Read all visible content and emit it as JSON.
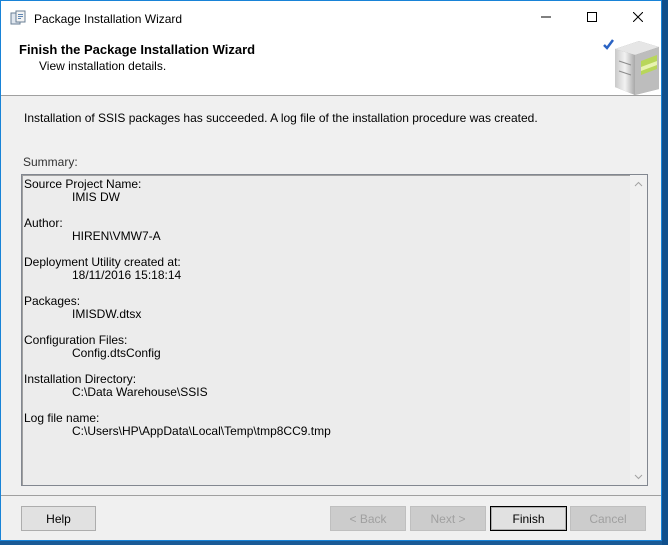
{
  "window": {
    "title": "Package Installation Wizard"
  },
  "header": {
    "title": "Finish the Package Installation Wizard",
    "subtitle": "View installation details."
  },
  "status": {
    "message": "Installation of SSIS packages has succeeded. A log file of the installation procedure was created."
  },
  "summary": {
    "label": "Summary:",
    "entries": [
      {
        "key": "Source Project Name:",
        "value": "IMIS DW"
      },
      {
        "key": "Author:",
        "value": "HIREN\\VMW7-A"
      },
      {
        "key": "Deployment Utility created at:",
        "value": "18/11/2016 15:18:14"
      },
      {
        "key": "Packages:",
        "value": "IMISDW.dtsx"
      },
      {
        "key": "Configuration Files:",
        "value": "Config.dtsConfig"
      },
      {
        "key": "Installation Directory:",
        "value": "C:\\Data Warehouse\\SSIS"
      },
      {
        "key": "Log file name:",
        "value": "C:\\Users\\HP\\AppData\\Local\\Temp\\tmp8CC9.tmp"
      }
    ]
  },
  "buttons": {
    "help": "Help",
    "back": "< Back",
    "next": "Next >",
    "finish": "Finish",
    "cancel": "Cancel"
  },
  "icons": {
    "app": "package-installer-icon",
    "header": "server-check-icon"
  },
  "colors": {
    "window_border": "#1883d7",
    "desktop": "#1a5a96",
    "summary_bg": "#ececec",
    "dialog_bg": "#f0f0f0"
  }
}
